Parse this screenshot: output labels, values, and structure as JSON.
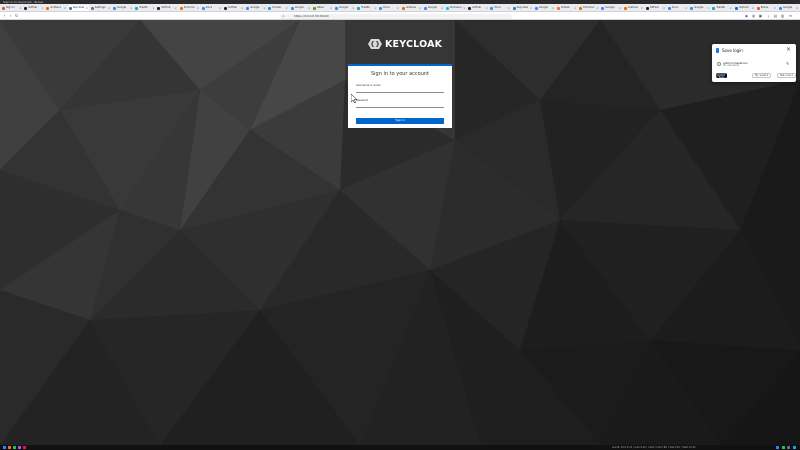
{
  "window": {
    "title": "Sign in to Keycloak - Brave"
  },
  "tabs": [
    {
      "label": "Sign In",
      "color": "#e8552f"
    },
    {
      "label": "GitHub",
      "color": "#24292e"
    },
    {
      "label": "Grafana",
      "color": "#f46800"
    },
    {
      "label": "Keycloak",
      "color": "#4d7aa0",
      "active": true
    },
    {
      "label": "Settings",
      "color": "#6b7280"
    },
    {
      "label": "Google",
      "color": "#4285f4"
    },
    {
      "label": "Traefik",
      "color": "#24a1c1"
    },
    {
      "label": "GitHub",
      "color": "#24292e"
    },
    {
      "label": "Proxmox",
      "color": "#e57000"
    },
    {
      "label": "Docs",
      "color": "#4285f4"
    },
    {
      "label": "GitHub",
      "color": "#24292e"
    },
    {
      "label": "Google",
      "color": "#4285f4"
    },
    {
      "label": "Docker",
      "color": "#2496ed"
    },
    {
      "label": "Google",
      "color": "#4285f4"
    },
    {
      "label": "Gitea",
      "color": "#609926"
    },
    {
      "label": "Google",
      "color": "#4285f4"
    },
    {
      "label": "Traefik",
      "color": "#24a1c1"
    },
    {
      "label": "Docs",
      "color": "#4285f4"
    },
    {
      "label": "Grafana",
      "color": "#f46800"
    },
    {
      "label": "Google",
      "color": "#4285f4"
    },
    {
      "label": "Portainer",
      "color": "#13bef9"
    },
    {
      "label": "GitHub",
      "color": "#24292e"
    },
    {
      "label": "Docs",
      "color": "#4285f4"
    },
    {
      "label": "Keycloak",
      "color": "#4d7aa0"
    },
    {
      "label": "Google",
      "color": "#4285f4"
    },
    {
      "label": "GitLab",
      "color": "#fc6d26"
    },
    {
      "label": "Proxmox",
      "color": "#e57000"
    },
    {
      "label": "Google",
      "color": "#4285f4"
    },
    {
      "label": "Grafana",
      "color": "#f46800"
    },
    {
      "label": "GitHub",
      "color": "#24292e"
    },
    {
      "label": "Docs",
      "color": "#4285f4"
    },
    {
      "label": "Google",
      "color": "#4285f4"
    },
    {
      "label": "Traefik",
      "color": "#24a1c1"
    },
    {
      "label": "Outlook",
      "color": "#0078d4"
    },
    {
      "label": "Brave",
      "color": "#fb542b"
    },
    {
      "label": "Google",
      "color": "#4285f4"
    }
  ],
  "nav": {
    "url": "https://10.0.0.50:8443/"
  },
  "page": {
    "logo_text": "KEYCLOAK",
    "title": "Sign in to your account",
    "username_label": "Username or email",
    "password_label": "Password",
    "signin_label": "Sign In"
  },
  "popup": {
    "title": "Save login",
    "site": "auth.homelab.lan",
    "user": "No username",
    "save_label": "Save",
    "folder_label": "My vault",
    "never_label": "Not now"
  },
  "taskbar": {
    "tray_text": "ens18: 10.0.0.21  |  load 0.42  |  mem 3.1G/7.8G  |  disk 41%  |  Wed 14:32"
  },
  "colors": {
    "accent": "#0066cc",
    "popup_accent": "#1a73e8"
  }
}
